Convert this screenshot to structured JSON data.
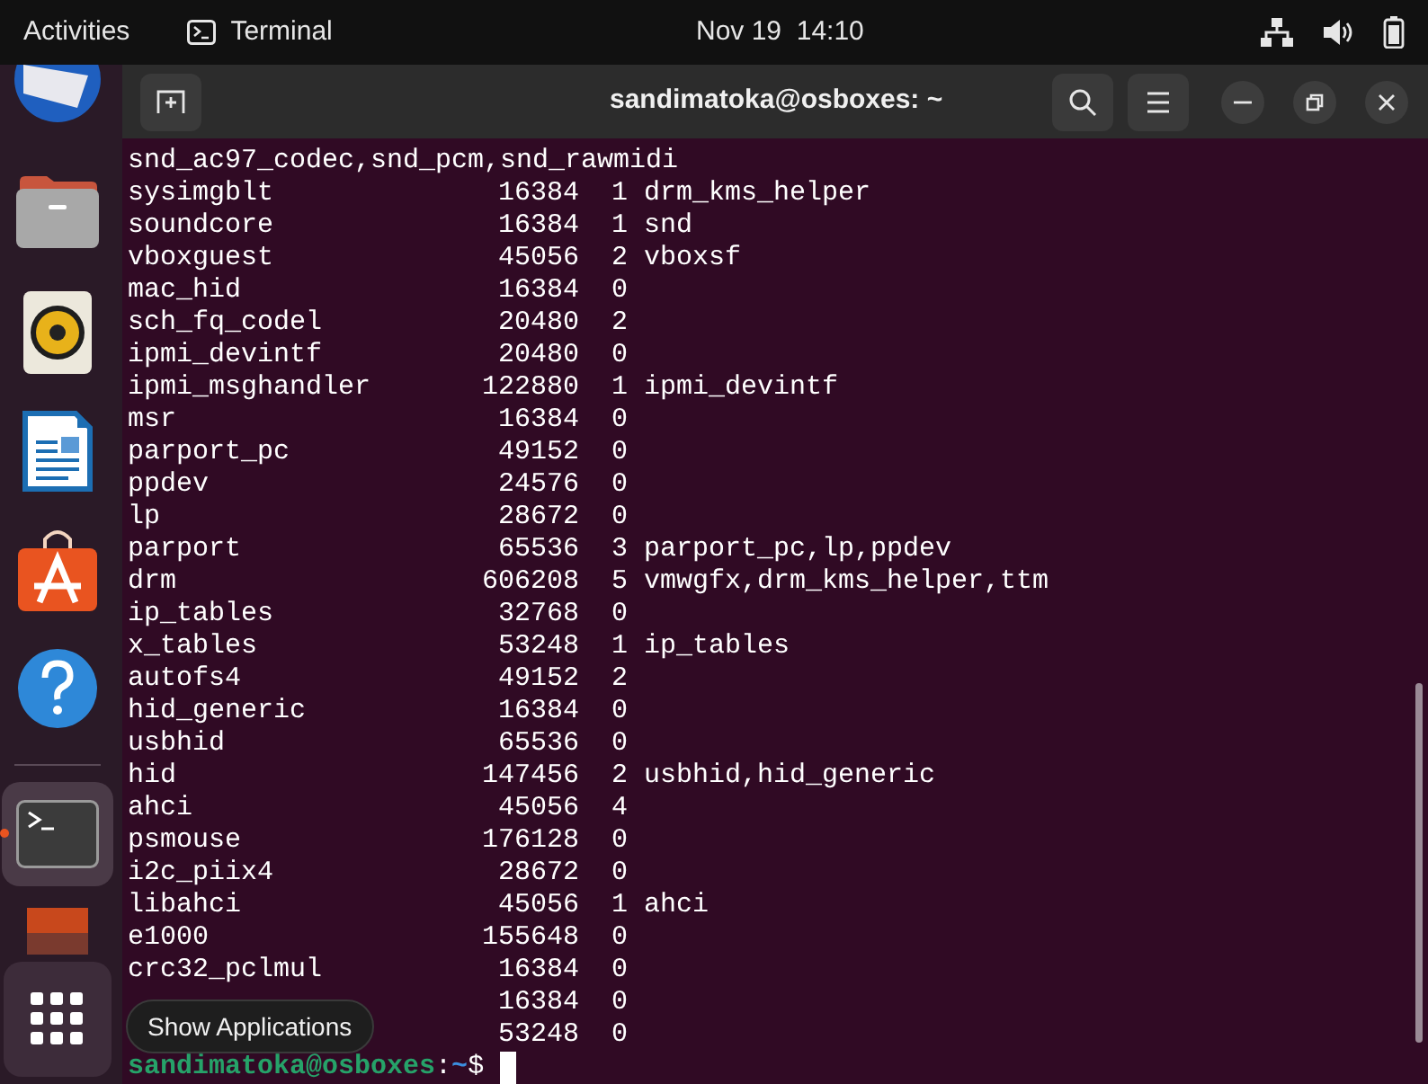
{
  "top_bar": {
    "activities": "Activities",
    "app_name": "Terminal",
    "clock": "Nov 19  14:10"
  },
  "dock": {
    "items": [
      {
        "kind": "mail",
        "active": false
      },
      {
        "kind": "files",
        "active": false
      },
      {
        "kind": "music",
        "active": false
      },
      {
        "kind": "writer",
        "active": false
      },
      {
        "kind": "store",
        "active": false
      },
      {
        "kind": "help",
        "active": false
      },
      {
        "kind": "terminal",
        "active": true
      },
      {
        "kind": "image",
        "active": false
      }
    ],
    "tooltip": "Show Applications"
  },
  "window": {
    "title": "sandimatoka@osboxes: ~"
  },
  "terminal": {
    "lines": [
      {
        "kind": "text",
        "text": "snd_ac97_codec,snd_pcm,snd_rawmidi"
      },
      {
        "kind": "row",
        "name": "sysimgblt",
        "size": "16384",
        "used": "1",
        "by": "drm_kms_helper"
      },
      {
        "kind": "row",
        "name": "soundcore",
        "size": "16384",
        "used": "1",
        "by": "snd"
      },
      {
        "kind": "row",
        "name": "vboxguest",
        "size": "45056",
        "used": "2",
        "by": "vboxsf"
      },
      {
        "kind": "row",
        "name": "mac_hid",
        "size": "16384",
        "used": "0"
      },
      {
        "kind": "row",
        "name": "sch_fq_codel",
        "size": "20480",
        "used": "2"
      },
      {
        "kind": "row",
        "name": "ipmi_devintf",
        "size": "20480",
        "used": "0"
      },
      {
        "kind": "row",
        "name": "ipmi_msghandler",
        "size": "122880",
        "used": "1",
        "by": "ipmi_devintf"
      },
      {
        "kind": "row",
        "name": "msr",
        "size": "16384",
        "used": "0"
      },
      {
        "kind": "row",
        "name": "parport_pc",
        "size": "49152",
        "used": "0"
      },
      {
        "kind": "row",
        "name": "ppdev",
        "size": "24576",
        "used": "0"
      },
      {
        "kind": "row",
        "name": "lp",
        "size": "28672",
        "used": "0"
      },
      {
        "kind": "row",
        "name": "parport",
        "size": "65536",
        "used": "3",
        "by": "parport_pc,lp,ppdev"
      },
      {
        "kind": "row",
        "name": "drm",
        "size": "606208",
        "used": "5",
        "by": "vmwgfx,drm_kms_helper,ttm"
      },
      {
        "kind": "row",
        "name": "ip_tables",
        "size": "32768",
        "used": "0"
      },
      {
        "kind": "row",
        "name": "x_tables",
        "size": "53248",
        "used": "1",
        "by": "ip_tables"
      },
      {
        "kind": "row",
        "name": "autofs4",
        "size": "49152",
        "used": "2"
      },
      {
        "kind": "row",
        "name": "hid_generic",
        "size": "16384",
        "used": "0"
      },
      {
        "kind": "row",
        "name": "usbhid",
        "size": "65536",
        "used": "0"
      },
      {
        "kind": "row",
        "name": "hid",
        "size": "147456",
        "used": "2",
        "by": "usbhid,hid_generic"
      },
      {
        "kind": "row",
        "name": "ahci",
        "size": "45056",
        "used": "4"
      },
      {
        "kind": "row",
        "name": "psmouse",
        "size": "176128",
        "used": "0"
      },
      {
        "kind": "row",
        "name": "i2c_piix4",
        "size": "28672",
        "used": "0"
      },
      {
        "kind": "row",
        "name": "libahci",
        "size": "45056",
        "used": "1",
        "by": "ahci"
      },
      {
        "kind": "row",
        "name": "e1000",
        "size": "155648",
        "used": "0"
      },
      {
        "kind": "row",
        "name": "crc32_pclmul",
        "size": "16384",
        "used": "0"
      },
      {
        "kind": "row",
        "size": "16384",
        "used": "0"
      },
      {
        "kind": "row",
        "size": "53248",
        "used": "0"
      }
    ],
    "prompt": {
      "user_host": "sandimatoka@osboxes",
      "separator": ":",
      "path": "~",
      "symbol": "$"
    }
  }
}
